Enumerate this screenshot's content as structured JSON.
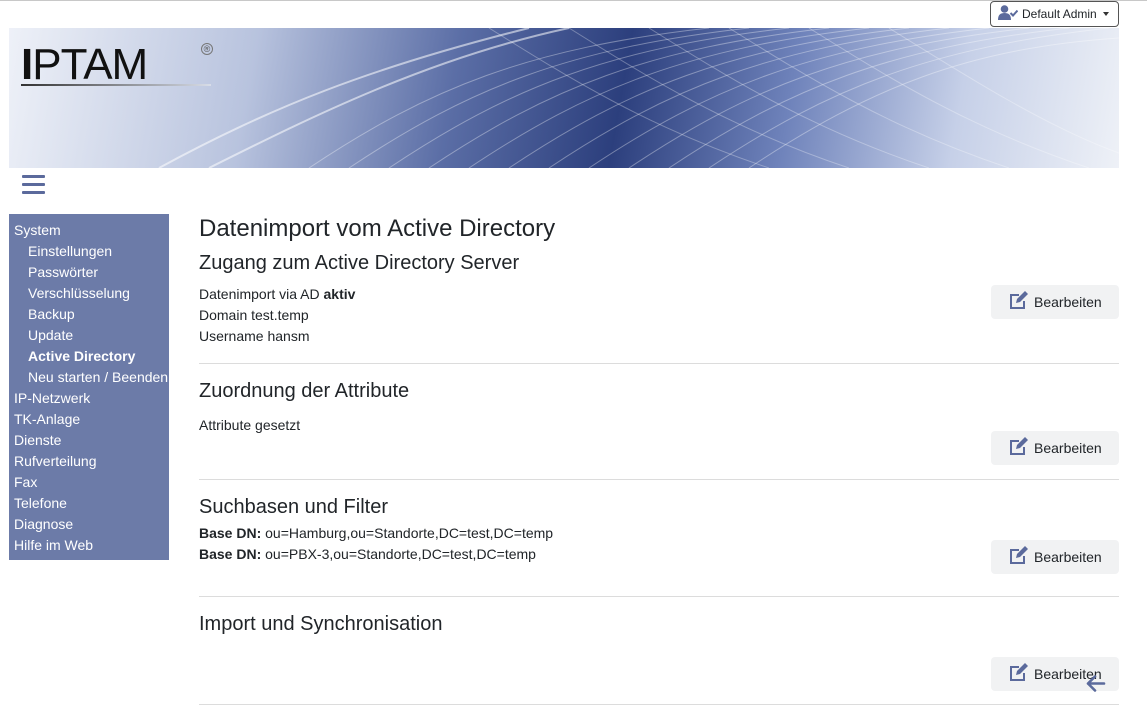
{
  "header": {
    "user_label": "Default Admin",
    "logo_text": "IPTAM",
    "logo_mark": "®"
  },
  "icons": {
    "user": "user-check-icon",
    "caret": "caret-down-icon",
    "menu": "hamburger-menu-icon",
    "edit": "edit-pencil-square-icon",
    "back": "arrow-left-icon"
  },
  "colors": {
    "sidebar_bg": "#6c7ba8",
    "accent": "#5b6a9c",
    "button_bg": "#f1f2f3"
  },
  "sidebar": {
    "items": [
      {
        "label": "System",
        "level": "top",
        "active": false
      },
      {
        "label": "Einstellungen",
        "level": "sub",
        "active": false
      },
      {
        "label": "Passwörter",
        "level": "sub",
        "active": false
      },
      {
        "label": "Verschlüsselung",
        "level": "sub",
        "active": false
      },
      {
        "label": "Backup",
        "level": "sub",
        "active": false
      },
      {
        "label": "Update",
        "level": "sub",
        "active": false
      },
      {
        "label": "Active Directory",
        "level": "sub",
        "active": true
      },
      {
        "label": "Neu starten / Beenden",
        "level": "sub",
        "active": false
      },
      {
        "label": "IP-Netzwerk",
        "level": "top",
        "active": false
      },
      {
        "label": "TK-Anlage",
        "level": "top",
        "active": false
      },
      {
        "label": "Dienste",
        "level": "top",
        "active": false
      },
      {
        "label": "Rufverteilung",
        "level": "top",
        "active": false
      },
      {
        "label": "Fax",
        "level": "top",
        "active": false
      },
      {
        "label": "Telefone",
        "level": "top",
        "active": false
      },
      {
        "label": "Diagnose",
        "level": "top",
        "active": false
      },
      {
        "label": "Hilfe im Web",
        "level": "top",
        "active": false
      }
    ]
  },
  "main": {
    "page_title": "Datenimport vom Active Directory",
    "edit_label": "Bearbeiten",
    "sections": {
      "access": {
        "title": "Zugang zum Active Directory Server",
        "import_prefix": "Datenimport via AD",
        "import_status": "aktiv",
        "domain_text": "Domain test.temp",
        "username_text": "Username hansm"
      },
      "attributes": {
        "title": "Zuordnung der Attribute",
        "status_text": "Attribute gesetzt"
      },
      "search": {
        "title": "Suchbasen und Filter",
        "base_dn_label": "Base DN:",
        "base_dns": [
          "ou=Hamburg,ou=Standorte,DC=test,DC=temp",
          "ou=PBX-3,ou=Standorte,DC=test,DC=temp"
        ]
      },
      "sync": {
        "title": "Import und Synchronisation"
      }
    }
  }
}
